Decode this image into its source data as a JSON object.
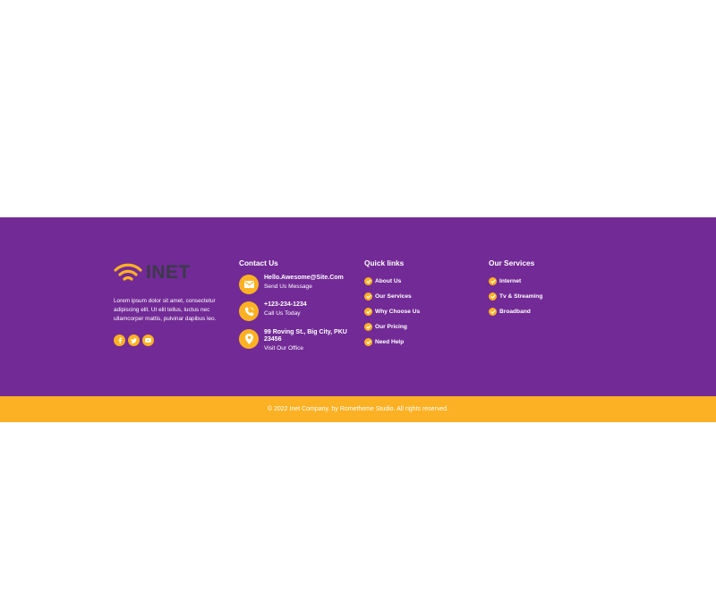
{
  "brand": {
    "name": "INET",
    "accent": "#fbb123",
    "footer_bg": "#722a96"
  },
  "about": {
    "text": "Lorem ipsum dolor sit amet, consectetur adipiscing elit. Ut elit tellus, luctus nec ullamcorper mattis, pulvinar dapibus leo."
  },
  "socials": [
    {
      "icon": "facebook-icon"
    },
    {
      "icon": "twitter-icon"
    },
    {
      "icon": "youtube-icon"
    }
  ],
  "contact": {
    "title": "Contact Us",
    "items": [
      {
        "icon": "envelope-icon",
        "main": "Hello.Awesome@Site.Com",
        "sub": "Send Us Message"
      },
      {
        "icon": "phone-icon",
        "main": "+123-234-1234",
        "sub": "Call Us Today"
      },
      {
        "icon": "map-pin-icon",
        "main": "99 Roving St., Big City, PKU 23456",
        "sub": "Visit Our Office"
      }
    ]
  },
  "quick_links": {
    "title": "Quick links",
    "items": [
      "About Us",
      "Our Services",
      "Why Choose Us",
      "Our Pricing",
      "Need Help"
    ]
  },
  "services": {
    "title": "Our Services",
    "items": [
      "Internet",
      "Tv & Streaming",
      "Broadband"
    ]
  },
  "copyright": "© 2022 Inet Company. by Rometheme Studio. All rights reserved."
}
